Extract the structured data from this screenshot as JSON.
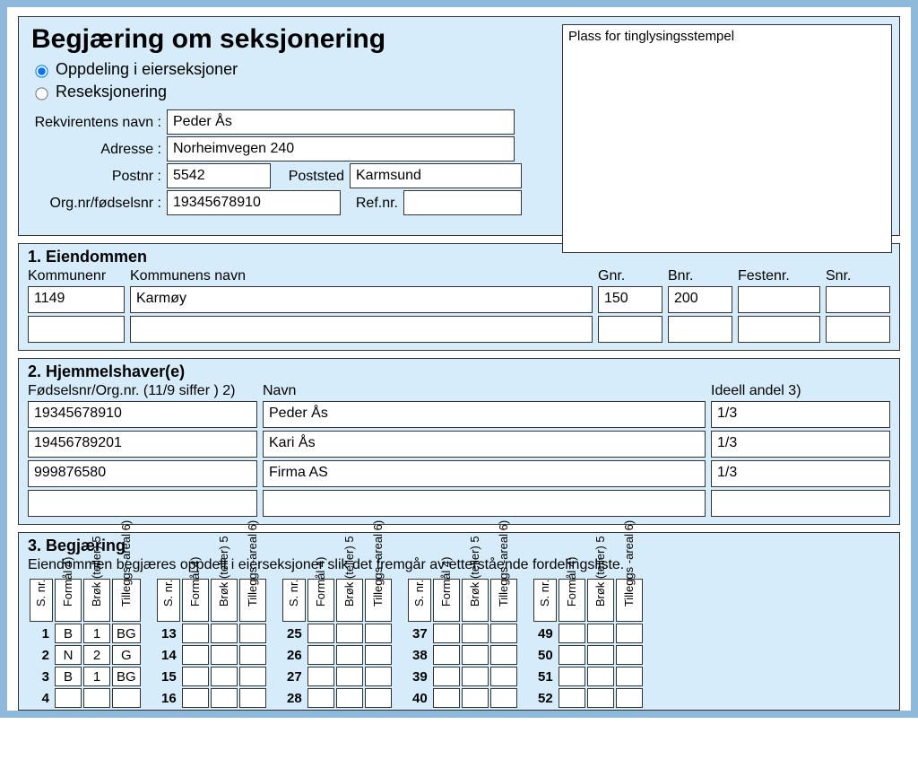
{
  "header": {
    "title": "Begjæring om seksjonering",
    "radio_oppdeling": "Oppdeling i eierseksjoner",
    "radio_reseksjonering": "Reseksjonering",
    "radio_selected": "oppdeling",
    "stamp_label": "Plass for tinglysingsstempel"
  },
  "rekvirent": {
    "name_label": "Rekvirentens navn :",
    "name": "Peder Ås",
    "address_label": "Adresse :",
    "address": "Norheimvegen 240",
    "postnr_label": "Postnr :",
    "postnr": "5542",
    "poststed_label": "Poststed",
    "poststed": "Karmsund",
    "org_label": "Org.nr/fødselsnr :",
    "org": "19345678910",
    "refnr_label": "Ref.nr.",
    "refnr": ""
  },
  "eiendommen": {
    "heading": "1. Eiendommen",
    "cols": {
      "kommunenr": "Kommunenr",
      "kommunenavn": "Kommunens navn",
      "gnr": "Gnr.",
      "bnr": "Bnr.",
      "festenr": "Festenr.",
      "snr": "Snr."
    },
    "rows": [
      {
        "kommunenr": "1149",
        "kommunenavn": "Karmøy",
        "gnr": "150",
        "bnr": "200",
        "festenr": "",
        "snr": ""
      },
      {
        "kommunenr": "",
        "kommunenavn": "",
        "gnr": "",
        "bnr": "",
        "festenr": "",
        "snr": ""
      }
    ]
  },
  "hjemmel": {
    "heading": "2. Hjemmelshaver(e)",
    "cols": {
      "fods": "Fødselsnr/Org.nr. (11/9 siffer ) 2)",
      "navn": "Navn",
      "andel": "Ideell andel 3)"
    },
    "rows": [
      {
        "fods": "19345678910",
        "navn": "Peder Ås",
        "andel": "1/3"
      },
      {
        "fods": "19456789201",
        "navn": "Kari Ås",
        "andel": "1/3"
      },
      {
        "fods": "999876580",
        "navn": "Firma AS",
        "andel": "1/3"
      },
      {
        "fods": "",
        "navn": "",
        "andel": ""
      }
    ]
  },
  "begjaering": {
    "heading": "3. Begjæring",
    "sub": "Eiendommen begjæres oppdelt i eierseksjoner slik det fremgår av etterstående fordelingsliste.",
    "th": {
      "snr": "S. nr.",
      "formaal": "Formål 4)",
      "brok": "Brøk (teller) 5",
      "tillegg": "Tilleggs -areal 6)"
    },
    "data": {
      "1": {
        "formaal": "B",
        "brok": "1",
        "tillegg": "BG"
      },
      "2": {
        "formaal": "N",
        "brok": "2",
        "tillegg": "G"
      },
      "3": {
        "formaal": "B",
        "brok": "1",
        "tillegg": "BG"
      }
    },
    "block_starts": [
      1,
      13,
      25,
      37,
      49
    ],
    "rows_visible": 4
  }
}
